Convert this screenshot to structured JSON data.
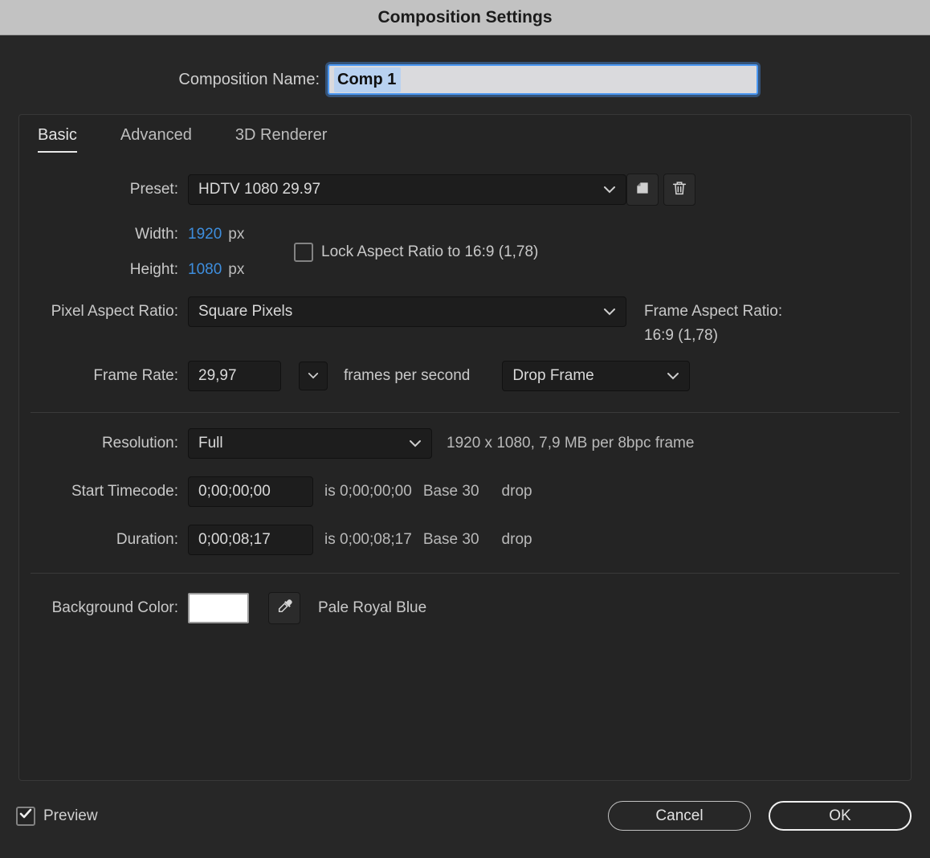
{
  "title": "Composition Settings",
  "composition_name": {
    "label": "Composition Name:",
    "value": "Comp 1"
  },
  "tabs": [
    {
      "label": "Basic",
      "active": true
    },
    {
      "label": "Advanced",
      "active": false
    },
    {
      "label": "3D Renderer",
      "active": false
    }
  ],
  "basic": {
    "preset": {
      "label": "Preset:",
      "value": "HDTV 1080 29.97"
    },
    "width": {
      "label": "Width:",
      "value": "1920",
      "unit": "px"
    },
    "lock_aspect": {
      "label": "Lock Aspect Ratio to 16:9 (1,78)",
      "checked": false
    },
    "height": {
      "label": "Height:",
      "value": "1080",
      "unit": "px"
    },
    "pixel_aspect_ratio": {
      "label": "Pixel Aspect Ratio:",
      "value": "Square Pixels"
    },
    "frame_aspect_ratio": {
      "label": "Frame Aspect Ratio:",
      "value": "16:9 (1,78)"
    },
    "frame_rate": {
      "label": "Frame Rate:",
      "value": "29,97",
      "suffix": "frames per second"
    },
    "timecode_base": {
      "value": "Drop Frame"
    },
    "resolution": {
      "label": "Resolution:",
      "value": "Full",
      "info": "1920 x 1080, 7,9 MB per 8bpc frame"
    },
    "start_timecode": {
      "label": "Start Timecode:",
      "value": "0;00;00;00",
      "is": "is 0;00;00;00",
      "base": "Base 30",
      "drop": "drop"
    },
    "duration": {
      "label": "Duration:",
      "value": "0;00;08;17",
      "is": "is 0;00;08;17",
      "base": "Base 30",
      "drop": "drop"
    },
    "background_color": {
      "label": "Background Color:",
      "swatch": "#ffffff",
      "name": "Pale Royal Blue"
    }
  },
  "footer": {
    "preview": {
      "label": "Preview",
      "checked": true
    },
    "cancel_label": "Cancel",
    "ok_label": "OK"
  },
  "colors": {
    "accent_blue": "#3e8ede",
    "titlebar_bg": "#c2c2c2",
    "dialog_bg": "#272727",
    "field_bg": "#1d1d1d",
    "selection_bg": "#b8d1f0"
  }
}
